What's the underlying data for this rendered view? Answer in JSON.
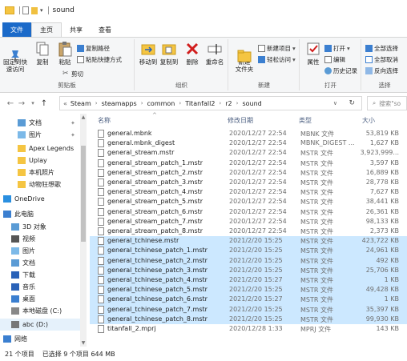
{
  "window": {
    "title": "sound"
  },
  "ribbon_tabs": [
    "文件",
    "主页",
    "共享",
    "查看"
  ],
  "ribbon": {
    "clipboard": {
      "label": "剪贴板",
      "pin": "固定到快\n速访问",
      "copy": "复制",
      "paste": "粘贴",
      "copy_path": "复制路径",
      "paste_shortcut": "粘贴快捷方式",
      "cut": "剪切"
    },
    "organize": {
      "label": "组织",
      "move_to": "移动到",
      "copy_to": "复制到",
      "delete": "删除",
      "rename": "重命名"
    },
    "new": {
      "label": "新建",
      "new_folder": "新建\n文件夹",
      "new_item": "新建项目",
      "easy_access": "轻松访问"
    },
    "open": {
      "label": "打开",
      "properties": "属性",
      "open": "打开",
      "edit": "编辑",
      "history": "历史记录"
    },
    "select": {
      "label": "选择",
      "select_all": "全部选择",
      "select_none": "全部取消",
      "invert": "反向选择"
    }
  },
  "address": {
    "crumbs": [
      "Steam",
      "steamapps",
      "common",
      "Titanfall2",
      "r2",
      "sound"
    ],
    "search_placeholder": "搜索\"so"
  },
  "sidebar": {
    "items": [
      {
        "label": "文档",
        "pinned": true
      },
      {
        "label": "图片",
        "pinned": true
      },
      {
        "label": "Apex Legends",
        "pinned": false
      },
      {
        "label": "Uplay",
        "pinned": false
      },
      {
        "label": "本机照片",
        "pinned": false
      },
      {
        "label": "动物狂想歌",
        "pinned": false
      },
      {
        "label": "OneDrive",
        "pinned": false
      },
      {
        "label": "此电脑",
        "pinned": false
      },
      {
        "label": "3D 对象",
        "pinned": false
      },
      {
        "label": "视频",
        "pinned": false
      },
      {
        "label": "图片",
        "pinned": false
      },
      {
        "label": "文档",
        "pinned": false
      },
      {
        "label": "下载",
        "pinned": false
      },
      {
        "label": "音乐",
        "pinned": false
      },
      {
        "label": "桌面",
        "pinned": false
      },
      {
        "label": "本地磁盘 (C:)",
        "pinned": false
      },
      {
        "label": "abc (D:)",
        "pinned": false
      },
      {
        "label": "网络",
        "pinned": false
      }
    ]
  },
  "columns": {
    "name": "名称",
    "date": "修改日期",
    "type": "类型",
    "size": "大小"
  },
  "files": [
    {
      "name": "general.mbnk",
      "date": "2020/12/27 22:54",
      "type": "MBNK 文件",
      "size": "53,819 KB",
      "selected": false
    },
    {
      "name": "general.mbnk_digest",
      "date": "2020/12/27 22:54",
      "type": "MBNK_DIGEST ...",
      "size": "1,627 KB",
      "selected": false
    },
    {
      "name": "general_stream.mstr",
      "date": "2020/12/27 22:54",
      "type": "MSTR 文件",
      "size": "3,923,999...",
      "selected": false
    },
    {
      "name": "general_stream_patch_1.mstr",
      "date": "2020/12/27 22:54",
      "type": "MSTR 文件",
      "size": "3,597 KB",
      "selected": false
    },
    {
      "name": "general_stream_patch_2.mstr",
      "date": "2020/12/27 22:54",
      "type": "MSTR 文件",
      "size": "16,889 KB",
      "selected": false
    },
    {
      "name": "general_stream_patch_3.mstr",
      "date": "2020/12/27 22:54",
      "type": "MSTR 文件",
      "size": "28,778 KB",
      "selected": false
    },
    {
      "name": "general_stream_patch_4.mstr",
      "date": "2020/12/27 22:54",
      "type": "MSTR 文件",
      "size": "7,627 KB",
      "selected": false
    },
    {
      "name": "general_stream_patch_5.mstr",
      "date": "2020/12/27 22:54",
      "type": "MSTR 文件",
      "size": "38,441 KB",
      "selected": false
    },
    {
      "name": "general_stream_patch_6.mstr",
      "date": "2020/12/27 22:54",
      "type": "MSTR 文件",
      "size": "26,361 KB",
      "selected": false
    },
    {
      "name": "general_stream_patch_7.mstr",
      "date": "2020/12/27 22:54",
      "type": "MSTR 文件",
      "size": "98,133 KB",
      "selected": false
    },
    {
      "name": "general_stream_patch_8.mstr",
      "date": "2020/12/27 22:54",
      "type": "MSTR 文件",
      "size": "2,373 KB",
      "selected": false
    },
    {
      "name": "general_tchinese.mstr",
      "date": "2021/2/20 15:25",
      "type": "MSTR 文件",
      "size": "423,722 KB",
      "selected": true
    },
    {
      "name": "general_tchinese_patch_1.mstr",
      "date": "2021/2/20 15:25",
      "type": "MSTR 文件",
      "size": "24,961 KB",
      "selected": true
    },
    {
      "name": "general_tchinese_patch_2.mstr",
      "date": "2021/2/20 15:25",
      "type": "MSTR 文件",
      "size": "492 KB",
      "selected": true
    },
    {
      "name": "general_tchinese_patch_3.mstr",
      "date": "2021/2/20 15:25",
      "type": "MSTR 文件",
      "size": "25,706 KB",
      "selected": true
    },
    {
      "name": "general_tchinese_patch_4.mstr",
      "date": "2021/2/20 15:27",
      "type": "MSTR 文件",
      "size": "1 KB",
      "selected": true
    },
    {
      "name": "general_tchinese_patch_5.mstr",
      "date": "2021/2/20 15:25",
      "type": "MSTR 文件",
      "size": "49,428 KB",
      "selected": true
    },
    {
      "name": "general_tchinese_patch_6.mstr",
      "date": "2021/2/20 15:27",
      "type": "MSTR 文件",
      "size": "1 KB",
      "selected": true
    },
    {
      "name": "general_tchinese_patch_7.mstr",
      "date": "2021/2/20 15:25",
      "type": "MSTR 文件",
      "size": "35,397 KB",
      "selected": true
    },
    {
      "name": "general_tchinese_patch_8.mstr",
      "date": "2021/2/20 15:25",
      "type": "MSTR 文件",
      "size": "99,930 KB",
      "selected": true
    },
    {
      "name": "titanfall_2.mprj",
      "date": "2020/12/28 1:33",
      "type": "MPRJ 文件",
      "size": "143 KB",
      "selected": false
    }
  ],
  "status": {
    "count": "21 个项目",
    "selected": "已选择 9 个项目  644 MB"
  }
}
